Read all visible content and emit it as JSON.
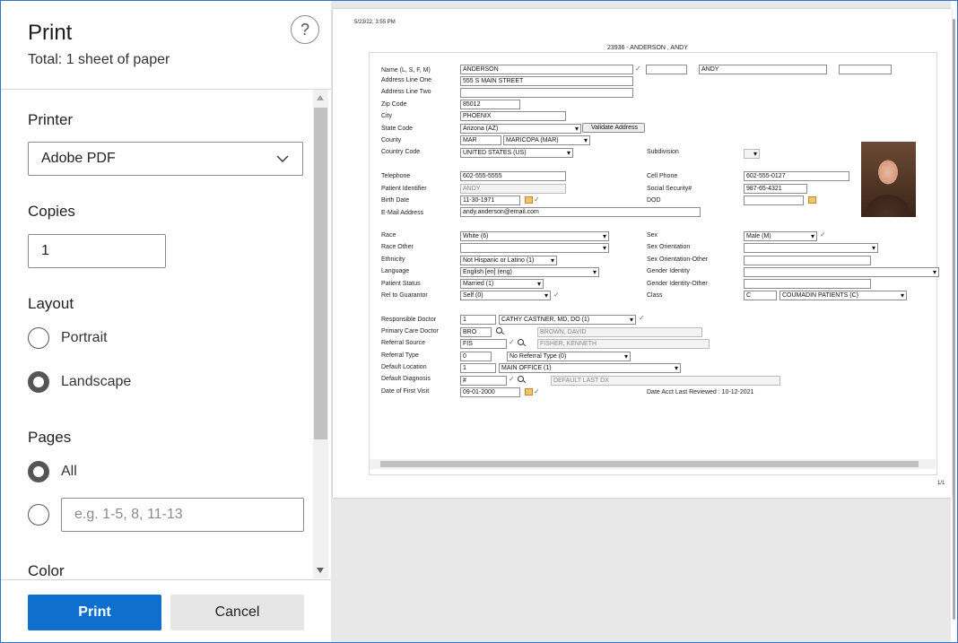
{
  "panel": {
    "title": "Print",
    "subtitle": "Total: 1 sheet of paper",
    "help_glyph": "?",
    "printer_label": "Printer",
    "printer_value": "Adobe PDF",
    "copies_label": "Copies",
    "copies_value": "1",
    "layout_label": "Layout",
    "layout_options": [
      "Portrait",
      "Landscape"
    ],
    "layout_selected": "Landscape",
    "pages_label": "Pages",
    "pages_all": "All",
    "pages_placeholder": "e.g. 1-5, 8, 11-13",
    "color_label": "Color",
    "print_button": "Print",
    "cancel_button": "Cancel"
  },
  "preview": {
    "timestamp": "5/23/22, 3:55 PM",
    "header": "23936 - ANDERSON , ANDY",
    "page_number": "1/1",
    "labels": {
      "name": "Name (L, S, F, M)",
      "addr1": "Address Line One",
      "addr2": "Address Line Two",
      "zip": "Zip Code",
      "city": "City",
      "state": "State Code",
      "county": "County",
      "country": "Country Code",
      "subdivision": "Subdivision",
      "telephone": "Telephone",
      "cell": "Cell Phone",
      "patient_id": "Patient Identifier",
      "ssn": "Social Security#",
      "birth": "Birth Date",
      "dod": "DOD",
      "email": "E-Mail Address",
      "race": "Race",
      "sex": "Sex",
      "race_other": "Race Other",
      "sex_orientation": "Sex Orientation",
      "ethnicity": "Ethnicity",
      "sex_orientation_other": "Sex Orientation-Other",
      "language": "Language",
      "gender_identity": "Gender Identity",
      "patient_status": "Patient Status",
      "gender_identity_other": "Gender Identity-Other",
      "rel_guarantor": "Rel to Guarantor",
      "class": "Class",
      "resp_doctor": "Responsible Doctor",
      "primary_doctor": "Primary Care Doctor",
      "referral_source": "Referral Source",
      "referral_type": "Referral Type",
      "default_location": "Default Location",
      "default_diagnosis": "Default Diagnosis",
      "first_visit": "Date of First Visit",
      "validate_button": "Validate Address",
      "last_reviewed": "Date Acct Last Reviewed : 10-12-2021"
    },
    "values": {
      "last_name": "ANDERSON",
      "first_name": "ANDY",
      "addr1": "555 S MAIN STREET",
      "zip": "85012",
      "city": "PHOENIX",
      "state": "Arizona (AZ)",
      "county_code": "MAR",
      "county_name": "MARICOPA (MAR)",
      "country": "UNITED STATES (US)",
      "telephone": "602-555-5555",
      "cell": "602-555-0127",
      "patient_id": "ANDY",
      "ssn": "987-65-4321",
      "birth": "11-30-1971",
      "email": "andy.anderson@email.com",
      "race": "White (6)",
      "sex": "Male (M)",
      "ethnicity": "Not Hispanic or Latino (1)",
      "language": "English [en] (eng)",
      "patient_status": "Married (1)",
      "rel_guarantor": "Self (0)",
      "class_code": "C",
      "class_name": "COUMADIN PATIENTS (C)",
      "resp_code": "1",
      "resp_name": "CATHY CASTNER, MD, DO (1)",
      "primary_code": "BRO",
      "primary_name": "BROWN, DAVID",
      "ref_source_code": "FIS",
      "ref_source_name": "FISHER, KENNETH",
      "ref_type_code": "0",
      "ref_type_name": "No Referral Type (0)",
      "location_code": "1",
      "location_name": "MAIN OFFICE (1)",
      "diag_code": "#",
      "diag_name": "DEFAULT LAST DX",
      "first_visit": "09-01-2000"
    }
  }
}
